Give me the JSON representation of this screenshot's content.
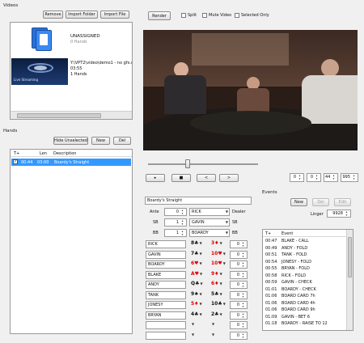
{
  "videos": {
    "group_label": "Videos",
    "remove": "Remove",
    "import_folder": "Import Folder",
    "import_file": "Import File",
    "items": [
      {
        "title": "UNASSIGNED",
        "sub": "0 Hands"
      },
      {
        "path": "Y:\\VPT2\\video\\demo1 - no gfx.r",
        "duration": "03:55",
        "hands": "1 Hands",
        "thumb_caption": "Live Streaming"
      }
    ]
  },
  "hands": {
    "group_label": "Hands",
    "hide_unselected": "Hide Unselected",
    "new": "New",
    "del": "Del",
    "columns": [
      "T+",
      "Len",
      "Description"
    ],
    "rows": [
      {
        "checked": true,
        "t": "00:44",
        "len": "03:00",
        "desc": "Boardy's Straight"
      }
    ]
  },
  "toolbar": {
    "render": "Render",
    "split": "Split",
    "mute": "Mute Video",
    "selected_only": "Selected Only"
  },
  "transport": {
    "play": "▸",
    "stop": "■",
    "prev": "<",
    "next": ">",
    "time": [
      "0",
      "0",
      "44",
      "995"
    ]
  },
  "hand_editor": {
    "description": "Boardy's Straight",
    "ante_label": "Ante",
    "ante": "0",
    "ante_player": "RICK",
    "dealer": "Dealer",
    "sb_label": "SB",
    "sb": "1",
    "sb_player": "GAVIN",
    "sb_right": "SB",
    "bb_label": "BB",
    "bb": "1",
    "bb_player": "BOARDY",
    "bb_right": "BB",
    "players": [
      {
        "name": "RICK",
        "c1": "8♣",
        "c1_red": false,
        "c2": "3♦",
        "c2_red": true,
        "stack": "0"
      },
      {
        "name": "GAVIN",
        "c1": "7♣",
        "c1_red": false,
        "c2": "10♥",
        "c2_red": true,
        "stack": "0"
      },
      {
        "name": "BOARDY",
        "c1": "6♥",
        "c1_red": true,
        "c2": "10♥",
        "c2_red": true,
        "stack": "0"
      },
      {
        "name": "BLAKE",
        "c1": "A♥",
        "c1_red": true,
        "c2": "9♦",
        "c2_red": true,
        "stack": "0"
      },
      {
        "name": "ANDY",
        "c1": "Q♣",
        "c1_red": false,
        "c2": "6♦",
        "c2_red": true,
        "stack": "0"
      },
      {
        "name": "TANK",
        "c1": "9♠",
        "c1_red": false,
        "c2": "5♣",
        "c2_red": false,
        "stack": "0"
      },
      {
        "name": "JONESY",
        "c1": "5♦",
        "c1_red": true,
        "c2": "10♣",
        "c2_red": false,
        "stack": "0"
      },
      {
        "name": "BRYAN",
        "c1": "4♣",
        "c1_red": false,
        "c2": "2♣",
        "c2_red": false,
        "stack": "0"
      },
      {
        "name": "",
        "c1": "",
        "c1_red": false,
        "c2": "",
        "c2_red": false,
        "stack": "0"
      },
      {
        "name": "",
        "c1": "",
        "c1_red": false,
        "c2": "",
        "c2_red": false,
        "stack": "0"
      }
    ]
  },
  "events": {
    "group_label": "Events",
    "new": "New",
    "del": "Del",
    "edit": "Edit",
    "linger_label": "Linger",
    "linger": "9928",
    "columns": [
      "T+",
      "Event"
    ],
    "rows": [
      {
        "t": "00:47",
        "e": "BLAKE - CALL"
      },
      {
        "t": "00:49",
        "e": "ANDY - FOLD"
      },
      {
        "t": "00:51",
        "e": "TANK - FOLD"
      },
      {
        "t": "00:54",
        "e": "JONESY - FOLD"
      },
      {
        "t": "00:55",
        "e": "BRYAN - FOLD"
      },
      {
        "t": "00:58",
        "e": "RICK - FOLD"
      },
      {
        "t": "00:59",
        "e": "GAVIN - CHECK"
      },
      {
        "t": "01:01",
        "e": "BOARDY - CHECK"
      },
      {
        "t": "01:06",
        "e": "BOARD CARD 7h"
      },
      {
        "t": "01:06",
        "e": "BOARD CARD 4h"
      },
      {
        "t": "01:06",
        "e": "BOARD CARD 9h"
      },
      {
        "t": "01:09",
        "e": "GAVIN - BET 6"
      },
      {
        "t": "01:18",
        "e": "BOARDY - RAISE TO 12"
      }
    ]
  },
  "colors": {
    "accent": "#3399ff",
    "selection": "#3399ff",
    "window_bg": "#f0f0f0",
    "red_suit": "#dd0000"
  }
}
